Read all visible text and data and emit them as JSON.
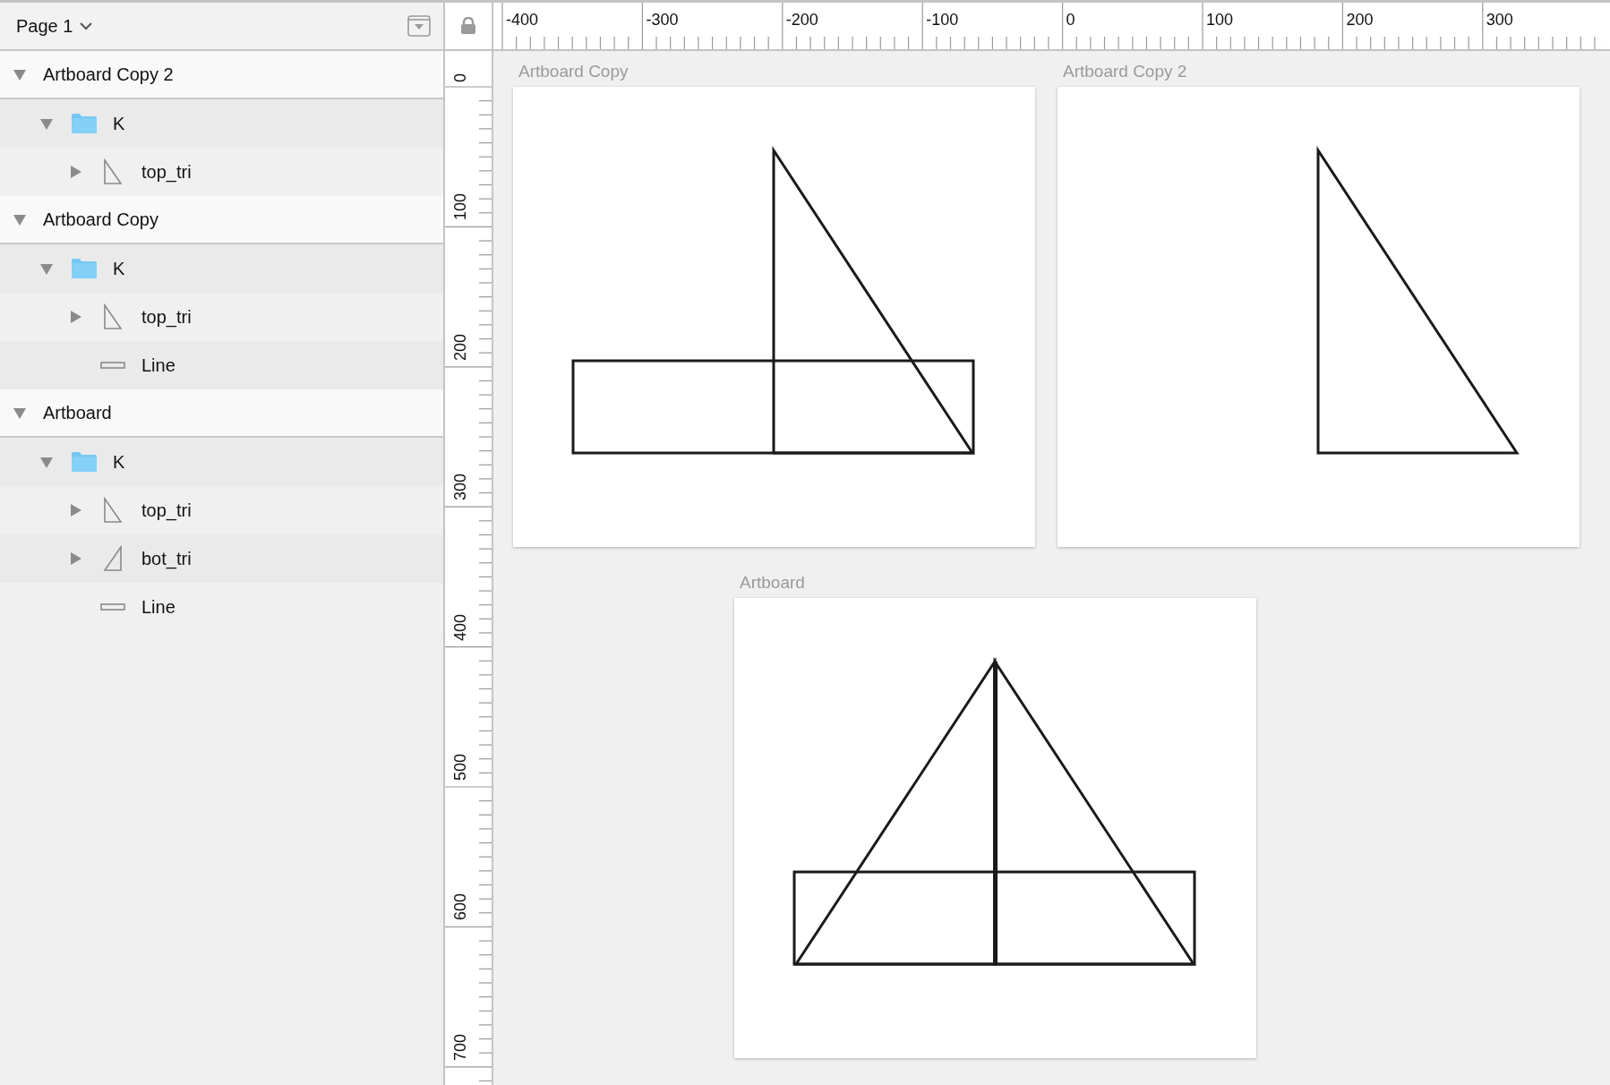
{
  "page_selector": {
    "label": "Page 1"
  },
  "layers": [
    {
      "name": "Artboard Copy 2",
      "kind": "artboard",
      "expanded": true,
      "children": [
        {
          "name": "K",
          "kind": "folder",
          "expanded": true,
          "children": [
            {
              "name": "top_tri",
              "kind": "right-triangle",
              "expanded": false
            }
          ]
        }
      ]
    },
    {
      "name": "Artboard Copy",
      "kind": "artboard",
      "expanded": true,
      "children": [
        {
          "name": "K",
          "kind": "folder",
          "expanded": true,
          "children": [
            {
              "name": "top_tri",
              "kind": "right-triangle",
              "expanded": false
            },
            {
              "name": "Line",
              "kind": "line"
            }
          ]
        }
      ]
    },
    {
      "name": "Artboard",
      "kind": "artboard",
      "expanded": true,
      "children": [
        {
          "name": "K",
          "kind": "folder",
          "expanded": true,
          "children": [
            {
              "name": "top_tri",
              "kind": "right-triangle",
              "expanded": false
            },
            {
              "name": "bot_tri",
              "kind": "left-triangle",
              "expanded": false
            },
            {
              "name": "Line",
              "kind": "line"
            }
          ]
        }
      ]
    }
  ],
  "horizontal_ruler": {
    "labels": [
      "-400",
      "-300",
      "-200",
      "-100",
      "0",
      "100",
      "200",
      "300"
    ]
  },
  "vertical_ruler": {
    "labels": [
      "0",
      "100",
      "200",
      "300",
      "400",
      "500",
      "600",
      "700"
    ]
  },
  "artboards": [
    {
      "title": "Artboard Copy",
      "shapes": [
        {
          "kind": "right-triangle"
        },
        {
          "kind": "rectangle"
        }
      ]
    },
    {
      "title": "Artboard Copy 2",
      "shapes": [
        {
          "kind": "right-triangle"
        }
      ]
    },
    {
      "title": "Artboard",
      "shapes": [
        {
          "kind": "left-triangle"
        },
        {
          "kind": "right-triangle"
        },
        {
          "kind": "rectangle"
        },
        {
          "kind": "vertical-line"
        }
      ]
    }
  ]
}
